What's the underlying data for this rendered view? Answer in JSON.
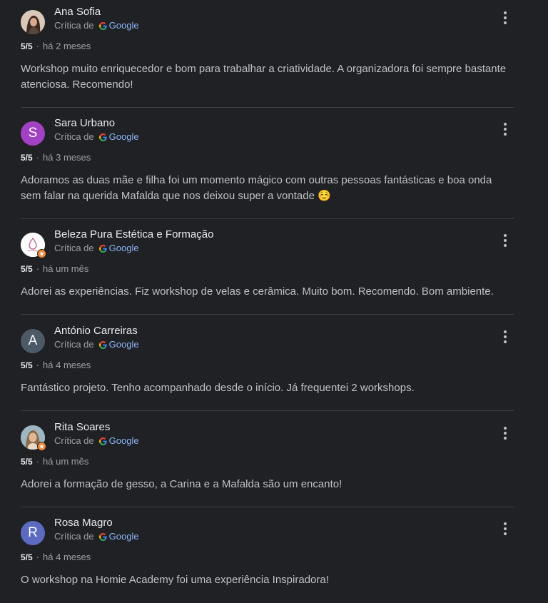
{
  "reviews": [
    {
      "name": "Ana Sofia",
      "critic_label": "Crítica de",
      "source": "Google",
      "score": "5/5",
      "time": "há 2 meses",
      "text": "Workshop muito enriquecedor e bom para trabalhar a criatividade. A organizadora foi sempre bastante atenciosa. Recomendo!",
      "avatar": {
        "type": "photo",
        "color": "#8a6a5a"
      }
    },
    {
      "name": "Sara Urbano",
      "critic_label": "Crítica de",
      "source": "Google",
      "score": "5/5",
      "time": "há 3 meses",
      "text": "Adoramos as duas mãe e filha foi um momento mágico com outras pessoas fantásticas e boa onda sem falar na querida Mafalda que nos deixou super a vontade ☺️",
      "avatar": {
        "type": "letter",
        "letter": "S",
        "color": "#a142c4"
      }
    },
    {
      "name": "Beleza Pura Estética e Formação",
      "critic_label": "Crítica de",
      "source": "Google",
      "score": "5/5",
      "time": "há um mês",
      "text": "Adorei as experiências. Fiz workshop de velas e cerâmica. Muito bom. Recomendo. Bom ambiente.",
      "avatar": {
        "type": "logo",
        "color": "#ffffff"
      }
    },
    {
      "name": "António Carreiras",
      "critic_label": "Crítica de",
      "source": "Google",
      "score": "5/5",
      "time": "há 4 meses",
      "text": "Fantástico projeto. Tenho acompanhado desde o início. Já frequentei 2 workshops.",
      "avatar": {
        "type": "letter",
        "letter": "A",
        "color": "#4b5a66"
      }
    },
    {
      "name": "Rita Soares",
      "critic_label": "Crítica de",
      "source": "Google",
      "score": "5/5",
      "time": "há um mês",
      "text": "Adorei a formação de gesso, a Carina e a Mafalda são um encanto!",
      "avatar": {
        "type": "photo",
        "color": "#c9a98a"
      }
    },
    {
      "name": "Rosa Magro",
      "critic_label": "Crítica de",
      "source": "Google",
      "score": "5/5",
      "time": "há 4 meses",
      "text": "O workshop na Homie Academy foi uma experiência Inspiradora!",
      "avatar": {
        "type": "letter",
        "letter": "R",
        "color": "#5c6bc0"
      }
    }
  ]
}
